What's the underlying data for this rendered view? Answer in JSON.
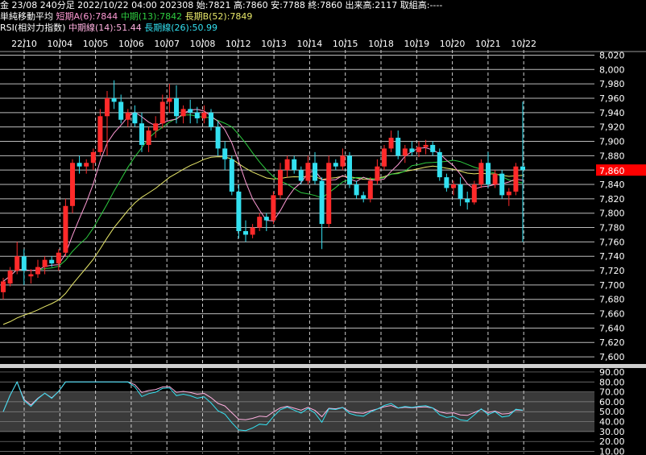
{
  "header": {
    "line1": "金 23/08 240分足 2022/10/22 04:00 202308 始:7821 高:7860 安:7788 終:7860 出来高:2117 取組高:----",
    "ma_title": "単純移動平均",
    "ma_short": "短期A(6):7844",
    "ma_mid": "中期(13):7842",
    "ma_long": "長期B(52):7849",
    "rsi_title": "RSI(相対力指数)",
    "rsi_mid": "中期線(14):51.44",
    "rsi_long": "長期線(26):50.99"
  },
  "colors": {
    "up": "#ff2a2a",
    "down": "#33e0f0",
    "ma_short": "#ff9ad5",
    "ma_mid": "#2ecc40",
    "ma_long": "#e8e86a",
    "rsi_mid": "#ffb0e0",
    "rsi_long": "#33e0f0",
    "price_tag": "#ff0000"
  },
  "chart_data": [
    {
      "type": "candlestick",
      "x_labels": [
        "22/10",
        "10/04",
        "10/05",
        "10/06",
        "10/07",
        "10/08",
        "10/12",
        "10/13",
        "10/14",
        "10/15",
        "10/18",
        "10/19",
        "10/20",
        "10/21",
        "10/22"
      ],
      "y_ticks": [
        "8,020",
        "8,000",
        "7,980",
        "7,960",
        "7,940",
        "7,920",
        "7,900",
        "7,880",
        "7,860",
        "7,840",
        "7,820",
        "7,800",
        "7,780",
        "7,760",
        "7,740",
        "7,720",
        "7,700",
        "7,680",
        "7,660",
        "7,640",
        "7,620",
        "7,600"
      ],
      "ylim": [
        7590,
        8025
      ],
      "last_price": "7,860",
      "series": [
        {
          "name": "短期A(6)"
        },
        {
          "name": "中期(13)"
        },
        {
          "name": "長期B(52)"
        }
      ],
      "candles": [
        [
          7690,
          7710,
          7680,
          7705
        ],
        [
          7702,
          7725,
          7698,
          7720
        ],
        [
          7720,
          7760,
          7715,
          7740
        ],
        [
          7740,
          7750,
          7700,
          7720
        ],
        [
          7712,
          7722,
          7702,
          7715
        ],
        [
          7715,
          7735,
          7710,
          7725
        ],
        [
          7725,
          7740,
          7715,
          7735
        ],
        [
          7735,
          7740,
          7725,
          7730
        ],
        [
          7730,
          7750,
          7720,
          7745
        ],
        [
          7745,
          7820,
          7740,
          7810
        ],
        [
          7810,
          7875,
          7800,
          7870
        ],
        [
          7870,
          7880,
          7855,
          7865
        ],
        [
          7865,
          7875,
          7855,
          7870
        ],
        [
          7870,
          7890,
          7860,
          7885
        ],
        [
          7885,
          7945,
          7880,
          7935
        ],
        [
          7935,
          7970,
          7880,
          7960
        ],
        [
          7960,
          7985,
          7945,
          7955
        ],
        [
          7955,
          7965,
          7925,
          7930
        ],
        [
          7930,
          7945,
          7920,
          7940
        ],
        [
          7940,
          7950,
          7920,
          7925
        ],
        [
          7925,
          7940,
          7885,
          7895
        ],
        [
          7895,
          7920,
          7885,
          7915
        ],
        [
          7915,
          7935,
          7905,
          7925
        ],
        [
          7925,
          7965,
          7918,
          7955
        ],
        [
          7955,
          7980,
          7940,
          7960
        ],
        [
          7960,
          7978,
          7925,
          7935
        ],
        [
          7935,
          7950,
          7925,
          7945
        ],
        [
          7945,
          7958,
          7925,
          7940
        ],
        [
          7940,
          7948,
          7925,
          7932
        ],
        [
          7932,
          7950,
          7925,
          7940
        ],
        [
          7940,
          7945,
          7915,
          7920
        ],
        [
          7920,
          7928,
          7880,
          7890
        ],
        [
          7890,
          7900,
          7860,
          7875
        ],
        [
          7875,
          7880,
          7825,
          7830
        ],
        [
          7830,
          7840,
          7765,
          7775
        ],
        [
          7775,
          7790,
          7760,
          7770
        ],
        [
          7770,
          7785,
          7765,
          7780
        ],
        [
          7780,
          7800,
          7775,
          7795
        ],
        [
          7795,
          7800,
          7775,
          7790
        ],
        [
          7790,
          7830,
          7785,
          7825
        ],
        [
          7825,
          7870,
          7820,
          7860
        ],
        [
          7860,
          7880,
          7850,
          7875
        ],
        [
          7875,
          7880,
          7855,
          7860
        ],
        [
          7860,
          7865,
          7840,
          7845
        ],
        [
          7845,
          7880,
          7840,
          7870
        ],
        [
          7870,
          7885,
          7840,
          7845
        ],
        [
          7845,
          7850,
          7750,
          7785
        ],
        [
          7785,
          7880,
          7780,
          7870
        ],
        [
          7870,
          7875,
          7860,
          7865
        ],
        [
          7865,
          7890,
          7860,
          7880
        ],
        [
          7880,
          7885,
          7835,
          7840
        ],
        [
          7840,
          7845,
          7820,
          7825
        ],
        [
          7825,
          7830,
          7815,
          7820
        ],
        [
          7820,
          7850,
          7815,
          7845
        ],
        [
          7845,
          7875,
          7840,
          7865
        ],
        [
          7865,
          7895,
          7860,
          7890
        ],
        [
          7890,
          7915,
          7885,
          7905
        ],
        [
          7905,
          7915,
          7875,
          7880
        ],
        [
          7880,
          7895,
          7870,
          7890
        ],
        [
          7890,
          7900,
          7880,
          7885
        ],
        [
          7885,
          7900,
          7878,
          7892
        ],
        [
          7892,
          7902,
          7882,
          7895
        ],
        [
          7895,
          7900,
          7880,
          7885
        ],
        [
          7885,
          7890,
          7845,
          7850
        ],
        [
          7850,
          7855,
          7830,
          7835
        ],
        [
          7835,
          7845,
          7825,
          7840
        ],
        [
          7840,
          7850,
          7810,
          7820
        ],
        [
          7820,
          7830,
          7805,
          7815
        ],
        [
          7815,
          7845,
          7812,
          7840
        ],
        [
          7840,
          7875,
          7835,
          7870
        ],
        [
          7870,
          7885,
          7835,
          7840
        ],
        [
          7840,
          7860,
          7835,
          7855
        ],
        [
          7855,
          7860,
          7820,
          7825
        ],
        [
          7825,
          7835,
          7810,
          7830
        ],
        [
          7830,
          7870,
          7825,
          7865
        ],
        [
          7865,
          7955,
          7760,
          7860
        ]
      ]
    },
    {
      "type": "line",
      "title": "RSI",
      "y_ticks": [
        "90.00",
        "80.00",
        "70.00",
        "60.00",
        "50.00",
        "40.00",
        "30.00",
        "20.00",
        "10.00"
      ],
      "ylim": [
        8,
        94
      ],
      "series": [
        {
          "name": "中期線(14)"
        },
        {
          "name": "長期線(26)"
        }
      ]
    }
  ]
}
